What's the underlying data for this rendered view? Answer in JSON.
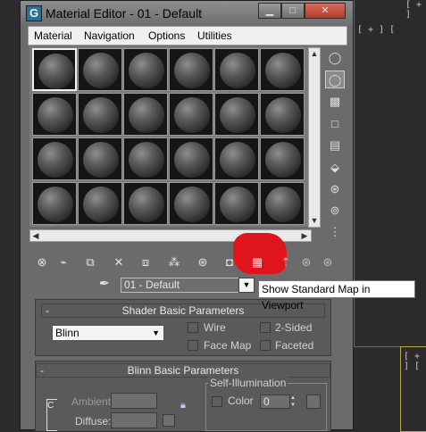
{
  "window": {
    "title": "Material Editor - 01 - Default",
    "app_icon_glyph": "G",
    "controls": [
      "minimize-icon",
      "maximize-icon",
      "close-icon"
    ]
  },
  "menu": [
    "Material",
    "Navigation",
    "Options",
    "Utilities"
  ],
  "sample_slots": {
    "rows": 4,
    "cols": 6,
    "active_index": 0
  },
  "sidebar_tools": [
    "sample-type-icon",
    "backlight-icon",
    "background-icon",
    "sample-uv-tiling-icon",
    "video-color-check-icon",
    "make-preview-icon",
    "options-icon",
    "select-by-material-icon",
    "material-map-navigator-icon"
  ],
  "toolbar": [
    "get-material-icon",
    "put-to-scene-icon",
    "assign-to-selection-icon",
    "reset-map-icon",
    "make-unique-icon",
    "put-to-library-icon",
    "material-effects-channel-icon",
    "show-shaded-material-icon",
    "show-standard-map-icon",
    "show-end-result-icon",
    "go-to-parent-icon",
    "go-forward-to-sibling-icon"
  ],
  "material_name": "01 - Default",
  "tooltip": "Show Standard Map in Viewport",
  "shader_basic": {
    "header": "Shader Basic Parameters",
    "collapse_symbol": "-",
    "shader": "Blinn",
    "checkboxes": [
      "Wire",
      "2-Sided",
      "Face Map",
      "Faceted"
    ]
  },
  "blinn_basic": {
    "header": "Blinn Basic Parameters",
    "collapse_symbol": "-",
    "ambient_label": "Ambient:",
    "diffuse_label": "Diffuse:",
    "lock_glyph": "C",
    "self_illum_group": "Self-Illumination",
    "color_label": "Color",
    "self_illum_value": "0"
  },
  "viewport_labels": [
    "[ + ]",
    "[ + ] [",
    "[ + ] ["
  ]
}
